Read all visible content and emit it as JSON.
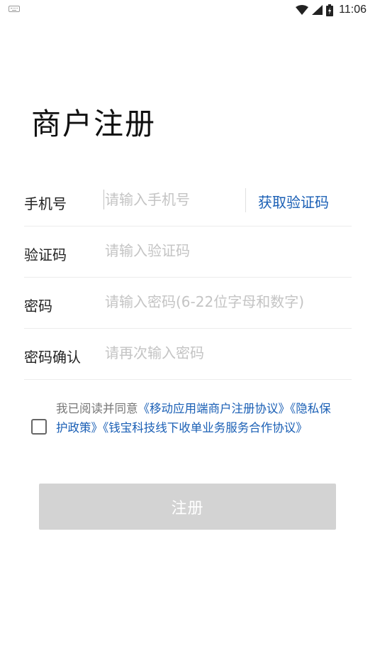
{
  "status_bar": {
    "time": "11:06",
    "icons": [
      "keyboard-icon",
      "wifi-icon",
      "signal-icon",
      "battery-icon"
    ]
  },
  "page": {
    "title": "商户注册"
  },
  "form": {
    "phone": {
      "label": "手机号",
      "placeholder": "请输入手机号",
      "value": ""
    },
    "get_code_label": "获取验证码",
    "code": {
      "label": "验证码",
      "placeholder": "请输入验证码",
      "value": ""
    },
    "password": {
      "label": "密码",
      "placeholder": "请输入密码(6-22位字母和数字)",
      "value": ""
    },
    "confirm": {
      "label": "密码确认",
      "placeholder": "请再次输入密码",
      "value": ""
    }
  },
  "agreement": {
    "checked": false,
    "prefix": "我已阅读并同意",
    "links": [
      "《移动应用端商户注册协议》",
      "《隐私保护政策》",
      "《钱宝科技线下收单业务服务合作协议》"
    ]
  },
  "submit": {
    "label": "注册"
  },
  "colors": {
    "link": "#1a5fb5",
    "button_disabled": "#d3d3d3",
    "placeholder": "#c4c4c4"
  }
}
